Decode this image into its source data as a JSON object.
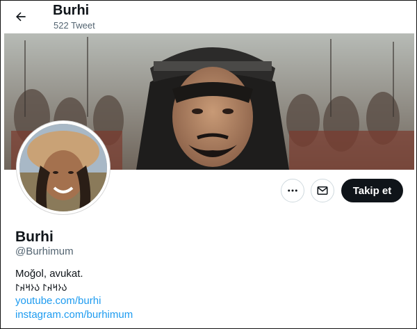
{
  "header": {
    "title": "Burhi",
    "tweet_count": "522 Tweet",
    "back_icon": "arrow-left-icon"
  },
  "profile": {
    "display_name": "Burhi",
    "handle": "@Burhimum",
    "bio_line_1": "Moğol, avukat.",
    "bio_line_2": "𐰉𐰆𐰺𐰴𐰃 𐰉𐰆𐰺𐰴𐰃",
    "links": [
      "youtube.com/burhi",
      "instagram.com/burhimum"
    ]
  },
  "actions": {
    "more_icon": "more-dots-icon",
    "message_icon": "envelope-icon",
    "follow_label": "Takip et"
  },
  "colors": {
    "link": "#1d9bf0",
    "follow_bg": "#0f1419",
    "muted": "#536471"
  }
}
